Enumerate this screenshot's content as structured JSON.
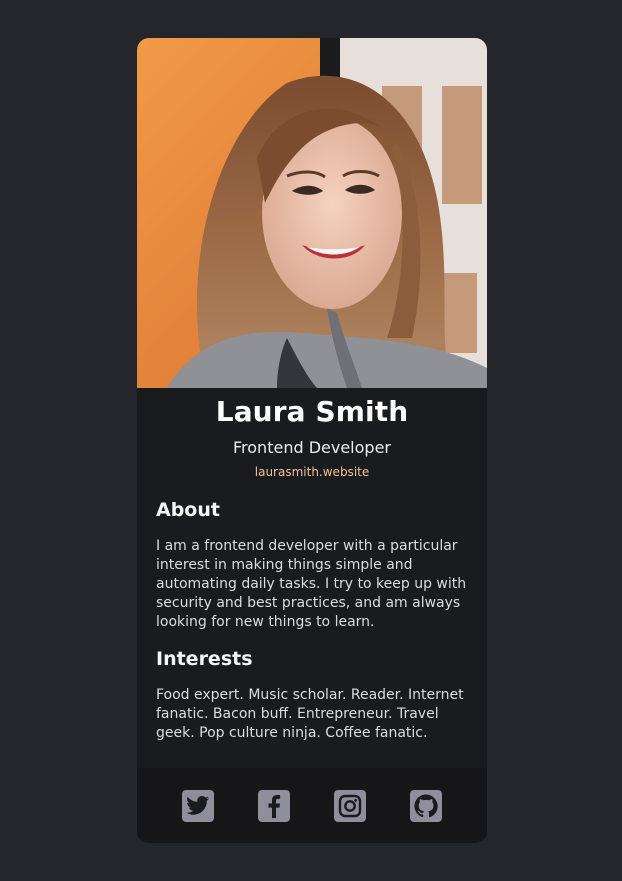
{
  "profile": {
    "name": "Laura Smith",
    "title": "Frontend Developer",
    "website": "laurasmith.website"
  },
  "about": {
    "heading": "About",
    "text": "I am a frontend developer with a particular interest in making things simple and automating daily tasks. I try to keep up with security and best practices, and am always looking for new things to learn."
  },
  "interests": {
    "heading": "Interests",
    "text": "Food expert. Music scholar. Reader. Internet fanatic. Bacon buff. Entrepreneur. Travel geek. Pop culture ninja. Coffee fanatic."
  },
  "footer": {
    "icons": [
      "twitter-icon",
      "facebook-icon",
      "instagram-icon",
      "github-icon"
    ]
  },
  "colors": {
    "page_background": "#24262c",
    "card_background": "#1a1b1f",
    "footer_background": "#161619",
    "accent": "#f3bf99",
    "icon": "#918e9b"
  }
}
